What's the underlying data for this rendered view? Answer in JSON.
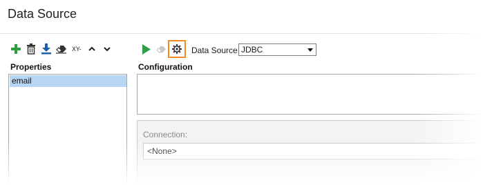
{
  "window": {
    "title": "Data Source"
  },
  "left_toolbar": {
    "icons": [
      "add-icon",
      "delete-icon",
      "download-icon",
      "eraser-icon",
      "xy-rename-icon",
      "move-up-icon",
      "move-down-icon"
    ],
    "xy_label": "XY-"
  },
  "properties": {
    "label": "Properties",
    "items": [
      "email"
    ],
    "selected": "email"
  },
  "right_toolbar": {
    "icons": [
      "run-icon",
      "clear-icon",
      "settings-icon"
    ],
    "data_source_label": "Data Source:",
    "data_source_value": "JDBC"
  },
  "configuration": {
    "label": "Configuration"
  },
  "connection": {
    "label": "Connection:",
    "value": "<None>"
  },
  "colors": {
    "add_green": "#2e9e3e",
    "run_green": "#2ea043",
    "download_blue": "#1b5fa8",
    "highlight_orange": "#f08a24",
    "selection_blue": "#b7d6f3"
  }
}
